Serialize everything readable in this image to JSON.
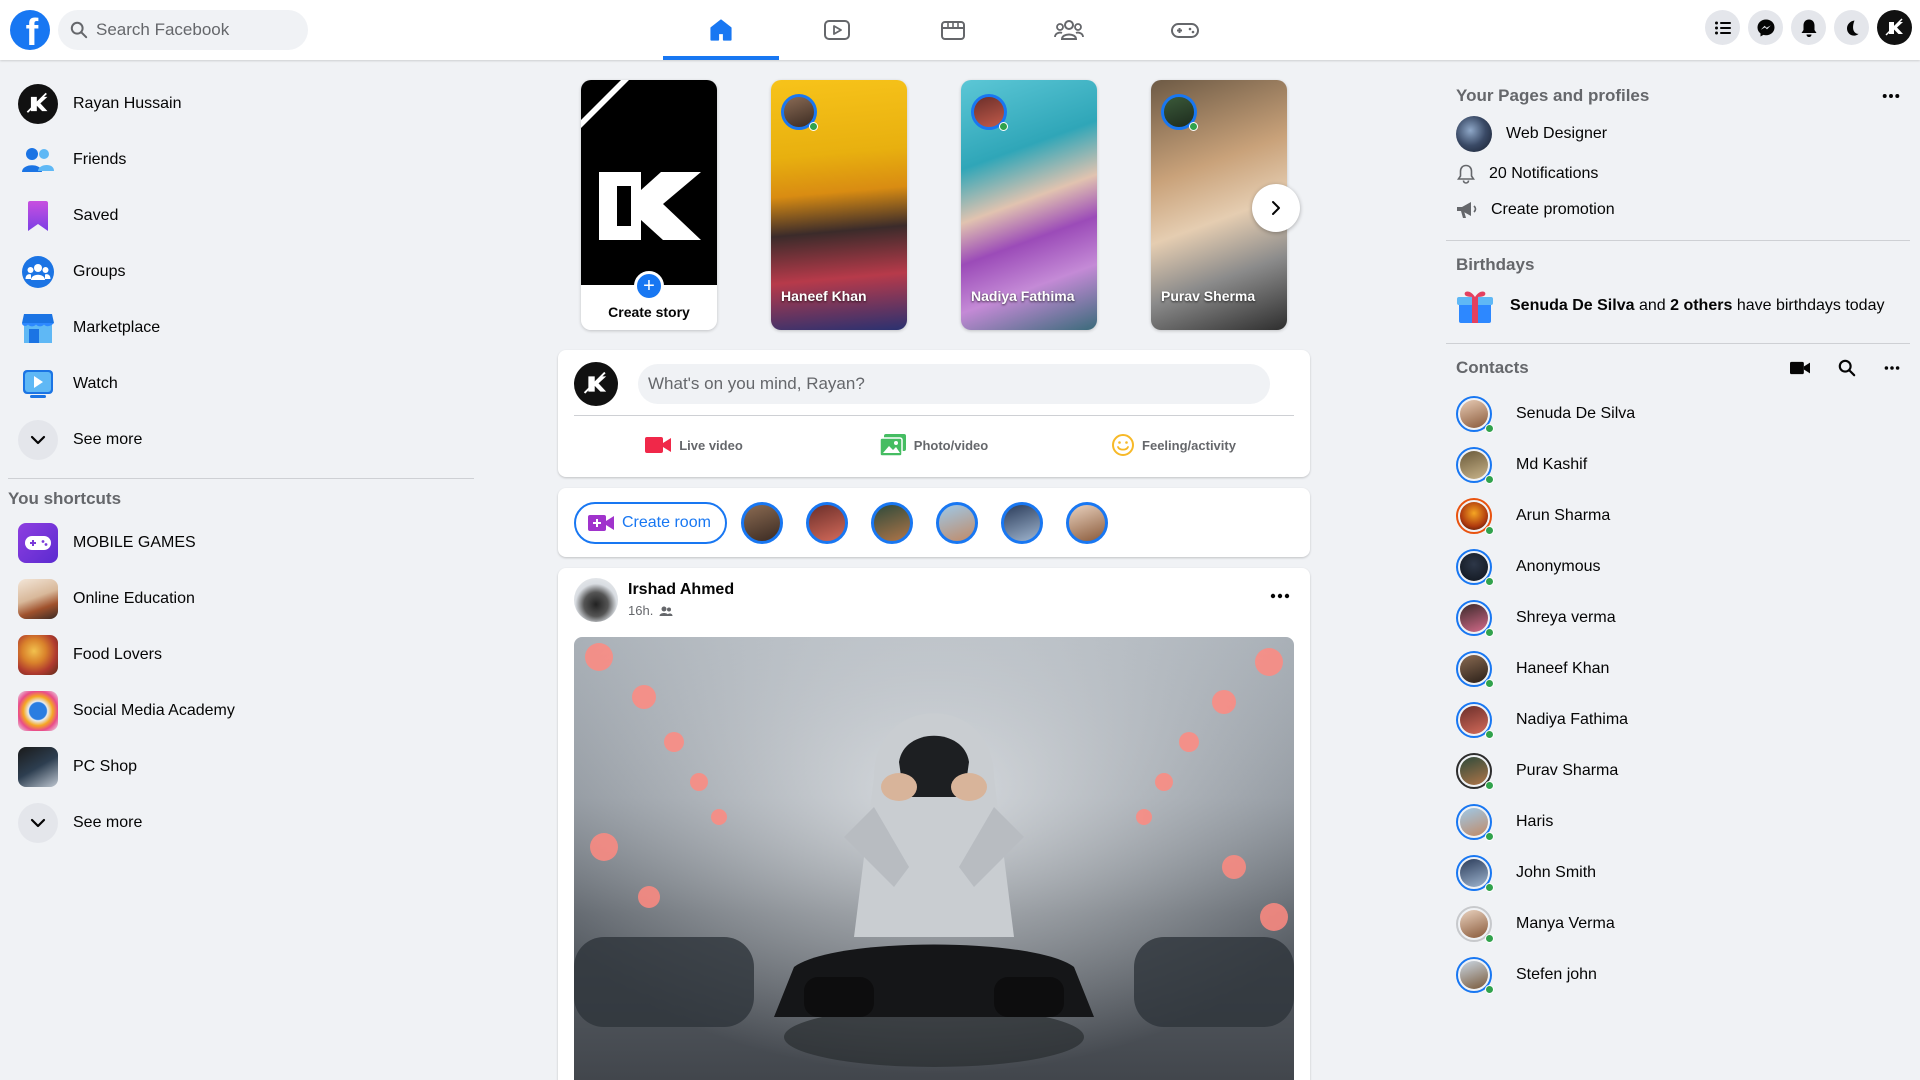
{
  "header": {
    "search_placeholder": "Search Facebook",
    "logo_letter": "f",
    "nav_tabs": [
      "home-icon",
      "watch-icon",
      "marketplace-icon",
      "groups-icon",
      "gaming-icon"
    ],
    "right_icons": [
      "menu-icon",
      "messenger-icon",
      "notifications-icon",
      "dark-mode-icon",
      "profile-avatar"
    ]
  },
  "left": {
    "items": [
      {
        "label": "Rayan Hussain",
        "icon": "profile-avatar"
      },
      {
        "label": "Friends",
        "icon": "friends-icon"
      },
      {
        "label": "Saved",
        "icon": "saved-icon"
      },
      {
        "label": "Groups",
        "icon": "groups-icon"
      },
      {
        "label": "Marketplace",
        "icon": "marketplace-icon"
      },
      {
        "label": "Watch",
        "icon": "watch-icon"
      },
      {
        "label": "See more",
        "icon": "chevron-down-icon"
      }
    ],
    "shortcuts_title": "You shortcuts",
    "shortcuts": [
      {
        "label": "MOBILE GAMES"
      },
      {
        "label": "Online Education"
      },
      {
        "label": "Food Lovers"
      },
      {
        "label": "Social Media Academy"
      },
      {
        "label": "PC Shop"
      },
      {
        "label": "See more"
      }
    ]
  },
  "stories": {
    "create_label": "Create story",
    "items": [
      {
        "name": "Haneef Khan"
      },
      {
        "name": "Nadiya Fathima"
      },
      {
        "name": "Purav Sherma"
      }
    ]
  },
  "composer": {
    "placeholder": "What's on you mind, Rayan?",
    "actions": [
      {
        "label": "Live video",
        "icon": "live-video-icon",
        "color": "#f02849"
      },
      {
        "label": "Photo/video",
        "icon": "photo-icon",
        "color": "#45bd62"
      },
      {
        "label": "Feeling/activity",
        "icon": "feeling-icon",
        "color": "#f7b928"
      }
    ]
  },
  "rooms": {
    "create_label": "Create room"
  },
  "post": {
    "author": "Irshad Ahmed",
    "time": "16h."
  },
  "right": {
    "pages_title": "Your Pages and profiles",
    "pages": [
      {
        "label": "Web Designer"
      },
      {
        "label": "20 Notifications"
      },
      {
        "label": "Create promotion"
      }
    ],
    "birthdays_title": "Birthdays",
    "birthday": {
      "name": "Senuda De Silva",
      "and": "and",
      "others": "2 others",
      "rest": "have birthdays today"
    },
    "contacts_title": "Contacts",
    "contacts": [
      "Senuda De Silva",
      "Md Kashif",
      "Arun Sharma",
      "Anonymous",
      "Shreya verma",
      "Haneef Khan",
      "Nadiya Fathima",
      "Purav Sharma",
      "Haris",
      "John Smith",
      "Manya Verma",
      "Stefen john"
    ]
  },
  "colors": {
    "brand": "#1877f2",
    "background": "#f0f2f5",
    "online": "#31a24c"
  }
}
